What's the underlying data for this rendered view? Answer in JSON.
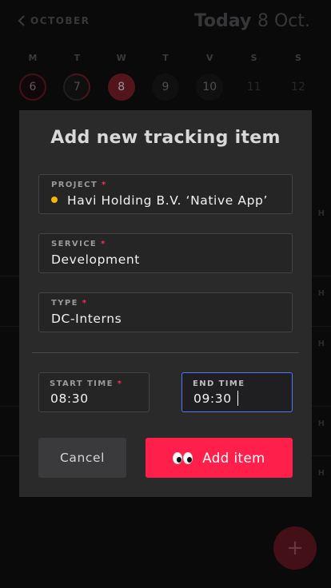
{
  "header": {
    "back_label": "OCTOBER",
    "today_word": "Today",
    "today_date": "8 Oct."
  },
  "week": [
    {
      "letter": "M",
      "num": "6",
      "state": "ring-full"
    },
    {
      "letter": "T",
      "num": "7",
      "state": "ring-part"
    },
    {
      "letter": "W",
      "num": "8",
      "state": "today-c"
    },
    {
      "letter": "T",
      "num": "9",
      "state": "dark"
    },
    {
      "letter": "V",
      "num": "10",
      "state": "dark"
    },
    {
      "letter": "S",
      "num": "11",
      "state": "none"
    },
    {
      "letter": "S",
      "num": "12",
      "state": "none"
    }
  ],
  "background_hour_marks": [
    "H",
    "H",
    "H",
    "H",
    "H"
  ],
  "fab": {
    "icon": "plus-icon",
    "glyph": "+"
  },
  "modal": {
    "title": "Add new tracking item",
    "project": {
      "label": "PROJECT",
      "required": "*",
      "value": "Havi Holding B.V. ‘Native App’",
      "dot_color": "#f5b50b"
    },
    "service": {
      "label": "SERVICE",
      "required": "*",
      "value": "Development"
    },
    "type": {
      "label": "TYPE",
      "required": "*",
      "value": "DC-Interns"
    },
    "start_time": {
      "label": "START TIME",
      "required": "*",
      "value": "08:30"
    },
    "end_time": {
      "label": "END TIME",
      "value": "09:30"
    },
    "cancel_label": "Cancel",
    "add_label": "Add item",
    "add_icon": "eyes-icon"
  },
  "colors": {
    "accent": "#ff1f4b",
    "focus": "#4d7cf2",
    "modal_bg": "#2a2a2b",
    "page_bg": "#0e0e0f"
  }
}
